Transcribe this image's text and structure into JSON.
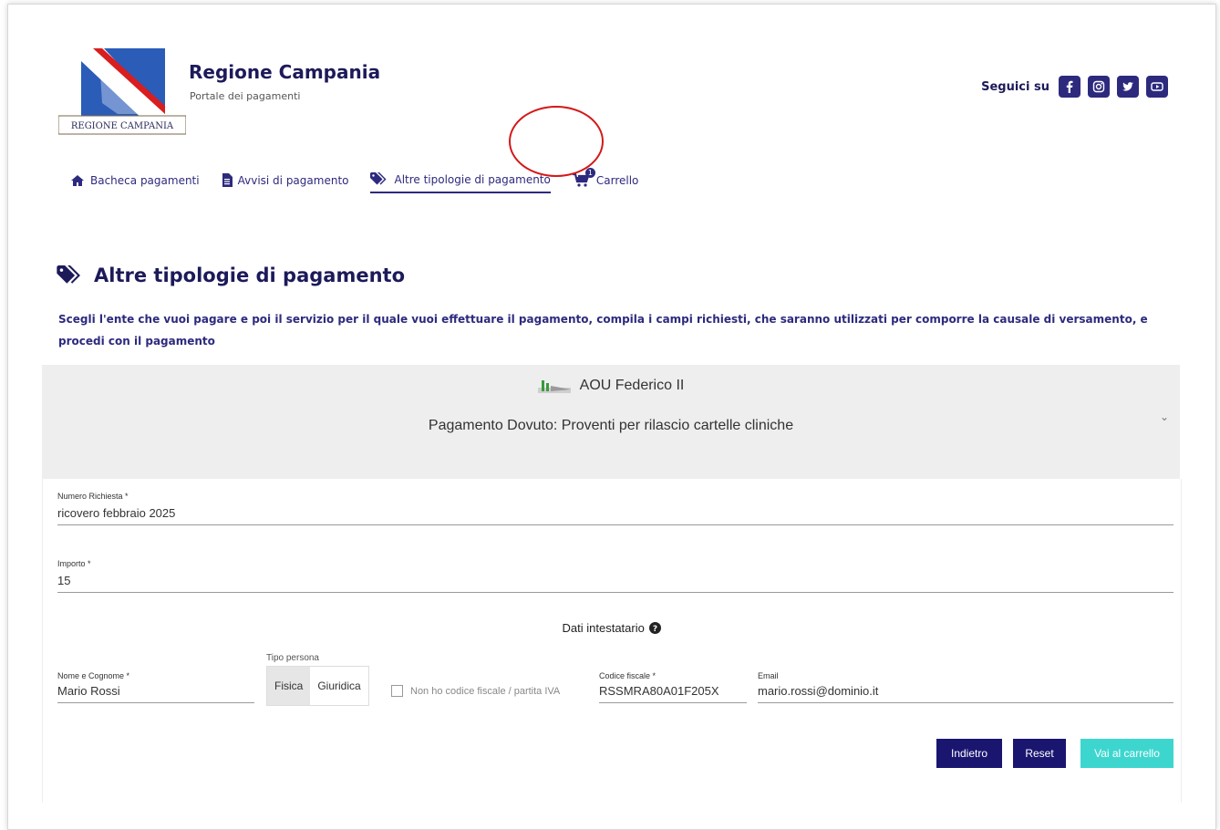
{
  "header": {
    "title": "Regione Campania",
    "subtitle": "Portale dei pagamenti",
    "logo_text": "REGIONE CAMPANIA",
    "social_label": "Seguici su",
    "social_icons": [
      "facebook-icon",
      "instagram-icon",
      "twitter-icon",
      "youtube-icon"
    ]
  },
  "nav": {
    "items": [
      {
        "label": "Bacheca pagamenti",
        "icon": "home-icon"
      },
      {
        "label": "Avvisi di pagamento",
        "icon": "document-icon"
      },
      {
        "label": "Altre tipologie di pagamento",
        "icon": "tags-icon",
        "active": true
      },
      {
        "label": "Carrello",
        "icon": "cart-icon",
        "badge": "1"
      }
    ]
  },
  "page": {
    "title": "Altre tipologie di pagamento",
    "description": "Scegli l'ente che vuoi pagare e poi il servizio per il quale vuoi effettuare il pagamento, compila i campi richiesti, che saranno utilizzati per comporre la causale di versamento, e procedi con il pagamento"
  },
  "accordion": {
    "entity": "AOU Federico II",
    "service": "Pagamento Dovuto: Proventi per rilascio cartelle cliniche"
  },
  "form": {
    "numero_richiesta": {
      "label": "Numero Richiesta *",
      "value": "ricovero febbraio 2025"
    },
    "importo": {
      "label": "Importo *",
      "value": "15"
    },
    "section_title": "Dati intestatario",
    "nome_cognome": {
      "label": "Nome e Cognome *",
      "value": "Mario Rossi"
    },
    "tipo_persona": {
      "label": "Tipo persona",
      "options": [
        "Fisica",
        "Giuridica"
      ],
      "selected": "Fisica"
    },
    "no_cf_label": "Non ho codice fiscale / partita IVA",
    "codice_fiscale": {
      "label": "Codice fiscale *",
      "value": "RSSMRA80A01F205X"
    },
    "email": {
      "label": "Email",
      "value": "mario.rossi@dominio.it"
    },
    "buttons": {
      "back": "Indietro",
      "reset": "Reset",
      "cart": "Vai al carrello"
    }
  },
  "colors": {
    "primary": "#2d2a7e",
    "teal": "#3dd6cf",
    "annotation": "#d41818"
  }
}
